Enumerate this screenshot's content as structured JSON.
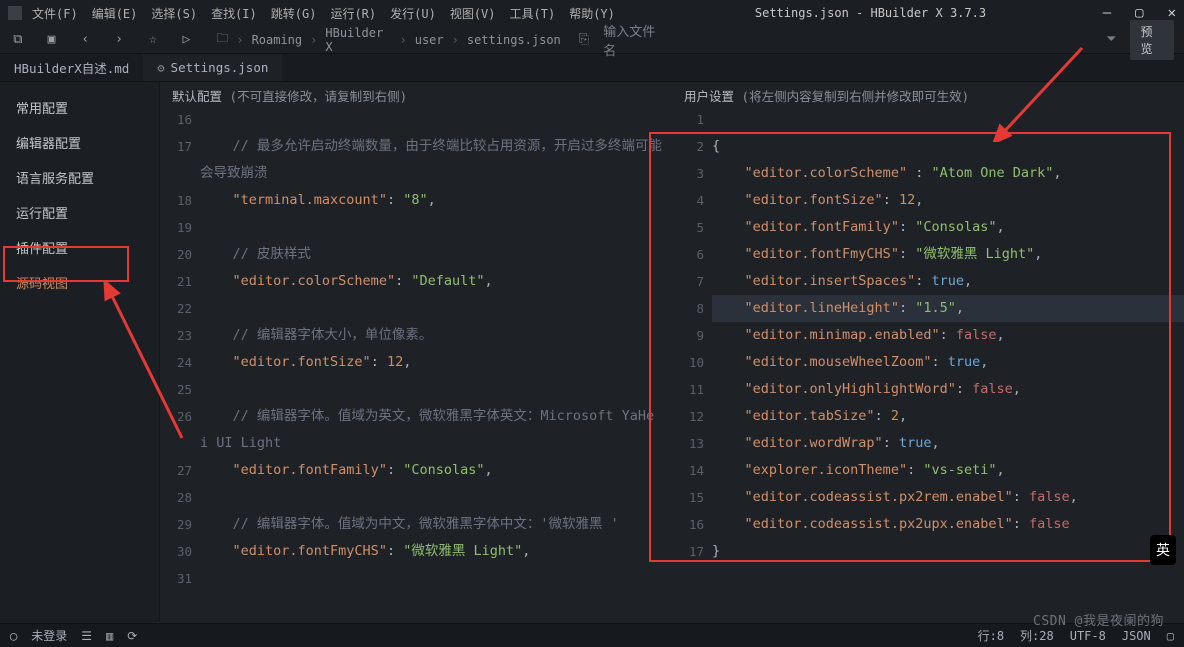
{
  "title": "Settings.json - HBuilder X 3.7.3",
  "menu": [
    "文件(F)",
    "编辑(E)",
    "选择(S)",
    "查找(I)",
    "跳转(G)",
    "运行(R)",
    "发行(U)",
    "视图(V)",
    "工具(T)",
    "帮助(Y)"
  ],
  "breadcrumb": [
    "Roaming",
    "HBuilder X",
    "user",
    "settings.json"
  ],
  "search_placeholder": "输入文件名",
  "search_label": "输入文件名",
  "preview_btn": "预览",
  "tabs": [
    {
      "label": "HBuilderX自述.md",
      "active": false
    },
    {
      "label": "Settings.json",
      "active": true,
      "icon": "gear"
    }
  ],
  "sidebar_items": [
    "常用配置",
    "编辑器配置",
    "语言服务配置",
    "运行配置",
    "插件配置",
    "源码视图"
  ],
  "sidebar_active": "源码视图",
  "left_header": {
    "title": "默认配置",
    "hint": "(不可直接修改，请复制到右侧)"
  },
  "right_header": {
    "title": "用户设置",
    "hint": "(将左侧内容复制到右侧并修改即可生效)"
  },
  "left_lines": [
    {
      "n": 16,
      "t": ""
    },
    {
      "n": 17,
      "t": "comment",
      "text": "// 最多允许启动终端数量，由于终端比较占用资源，开启过多终端可能会导致崩溃"
    },
    {
      "n": 18,
      "t": "kv",
      "key": "terminal.maxcount",
      "val": "\"8\"",
      "vt": "str"
    },
    {
      "n": 19,
      "t": ""
    },
    {
      "n": 20,
      "t": "comment",
      "text": "// 皮肤样式"
    },
    {
      "n": 21,
      "t": "kv",
      "key": "editor.colorScheme",
      "val": "\"Default\"",
      "vt": "str"
    },
    {
      "n": 22,
      "t": ""
    },
    {
      "n": 23,
      "t": "comment",
      "text": "// 编辑器字体大小，单位像素。"
    },
    {
      "n": 24,
      "t": "kv",
      "key": "editor.fontSize",
      "val": "12",
      "vt": "num"
    },
    {
      "n": 25,
      "t": ""
    },
    {
      "n": 26,
      "t": "comment",
      "text": "// 编辑器字体。值域为英文，微软雅黑字体英文：Microsoft YaHei UI Light"
    },
    {
      "n": 27,
      "t": "kv",
      "key": "editor.fontFamily",
      "val": "\"Consolas\"",
      "vt": "str"
    },
    {
      "n": 28,
      "t": ""
    },
    {
      "n": 29,
      "t": "comment",
      "text": "// 编辑器字体。值域为中文，微软雅黑字体中文：'微软雅黑 '"
    },
    {
      "n": 30,
      "t": "kv",
      "key": "editor.fontFmyCHS",
      "val": "\"微软雅黑 Light\"",
      "vt": "str"
    },
    {
      "n": 31,
      "t": ""
    }
  ],
  "right_lines": [
    {
      "n": 1,
      "t": ""
    },
    {
      "n": 2,
      "t": "brace",
      "ch": "{"
    },
    {
      "n": 3,
      "t": "kv",
      "key": "editor.colorScheme",
      "sep": " : ",
      "val": "\"Atom One Dark\"",
      "vt": "str"
    },
    {
      "n": 4,
      "t": "kv",
      "key": "editor.fontSize",
      "val": "12",
      "vt": "num"
    },
    {
      "n": 5,
      "t": "kv",
      "key": "editor.fontFamily",
      "val": "\"Consolas\"",
      "vt": "str"
    },
    {
      "n": 6,
      "t": "kv",
      "key": "editor.fontFmyCHS",
      "val": "\"微软雅黑 Light\"",
      "vt": "str"
    },
    {
      "n": 7,
      "t": "kv",
      "key": "editor.insertSpaces",
      "val": "true",
      "vt": "bool-t"
    },
    {
      "n": 8,
      "t": "kv",
      "key": "editor.lineHeight",
      "val": "\"1.5\"",
      "vt": "str",
      "hl": true
    },
    {
      "n": 9,
      "t": "kv",
      "key": "editor.minimap.enabled",
      "val": "false",
      "vt": "bool-f"
    },
    {
      "n": 10,
      "t": "kv",
      "key": "editor.mouseWheelZoom",
      "val": "true",
      "vt": "bool-t"
    },
    {
      "n": 11,
      "t": "kv",
      "key": "editor.onlyHighlightWord",
      "val": "false",
      "vt": "bool-f"
    },
    {
      "n": 12,
      "t": "kv",
      "key": "editor.tabSize",
      "val": "2",
      "vt": "num"
    },
    {
      "n": 13,
      "t": "kv",
      "key": "editor.wordWrap",
      "val": "true",
      "vt": "bool-t"
    },
    {
      "n": 14,
      "t": "kv",
      "key": "explorer.iconTheme",
      "val": "\"vs-seti\"",
      "vt": "str"
    },
    {
      "n": 15,
      "t": "kv",
      "key": "editor.codeassist.px2rem.enabel",
      "val": "false",
      "vt": "bool-f"
    },
    {
      "n": 16,
      "t": "kv",
      "key": "editor.codeassist.px2upx.enabel",
      "val": "false",
      "vt": "bool-f",
      "last": true
    },
    {
      "n": 17,
      "t": "brace",
      "ch": "}"
    }
  ],
  "status": {
    "login": "未登录",
    "line": "行:8",
    "col": "列:28",
    "encoding": "UTF-8",
    "syntax": "JSON"
  },
  "watermark": "CSDN @我是夜阑的狗",
  "ime": "英"
}
